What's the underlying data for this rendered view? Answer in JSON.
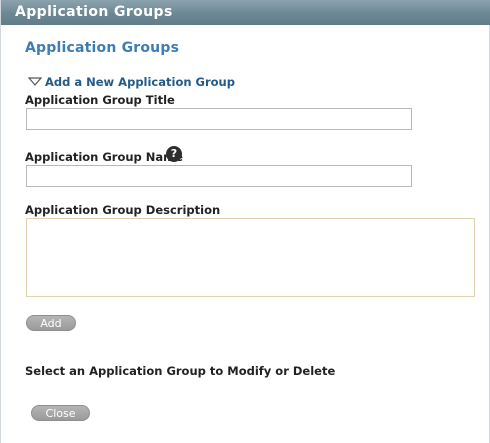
{
  "window": {
    "title": "Application Groups"
  },
  "section": {
    "title": "Application Groups",
    "toggle_label": "Add a New Application Group"
  },
  "form": {
    "title_label": "Application Group Title",
    "title_value": "",
    "name_label": "Application Group Name",
    "name_value": "",
    "help_glyph": "?",
    "description_label": "Application Group Description",
    "description_value": "",
    "add_label": "Add"
  },
  "list": {
    "instruction": "Select an Application Group to Modify or Delete"
  },
  "footer": {
    "close_label": "Close"
  },
  "icons": {
    "toggle": "triangle-down-icon",
    "help": "question-help-icon"
  },
  "colors": {
    "titlebar": "#6c8894",
    "section_title": "#3e7db3",
    "link": "#225a8a",
    "button": "#9a9a9a"
  }
}
